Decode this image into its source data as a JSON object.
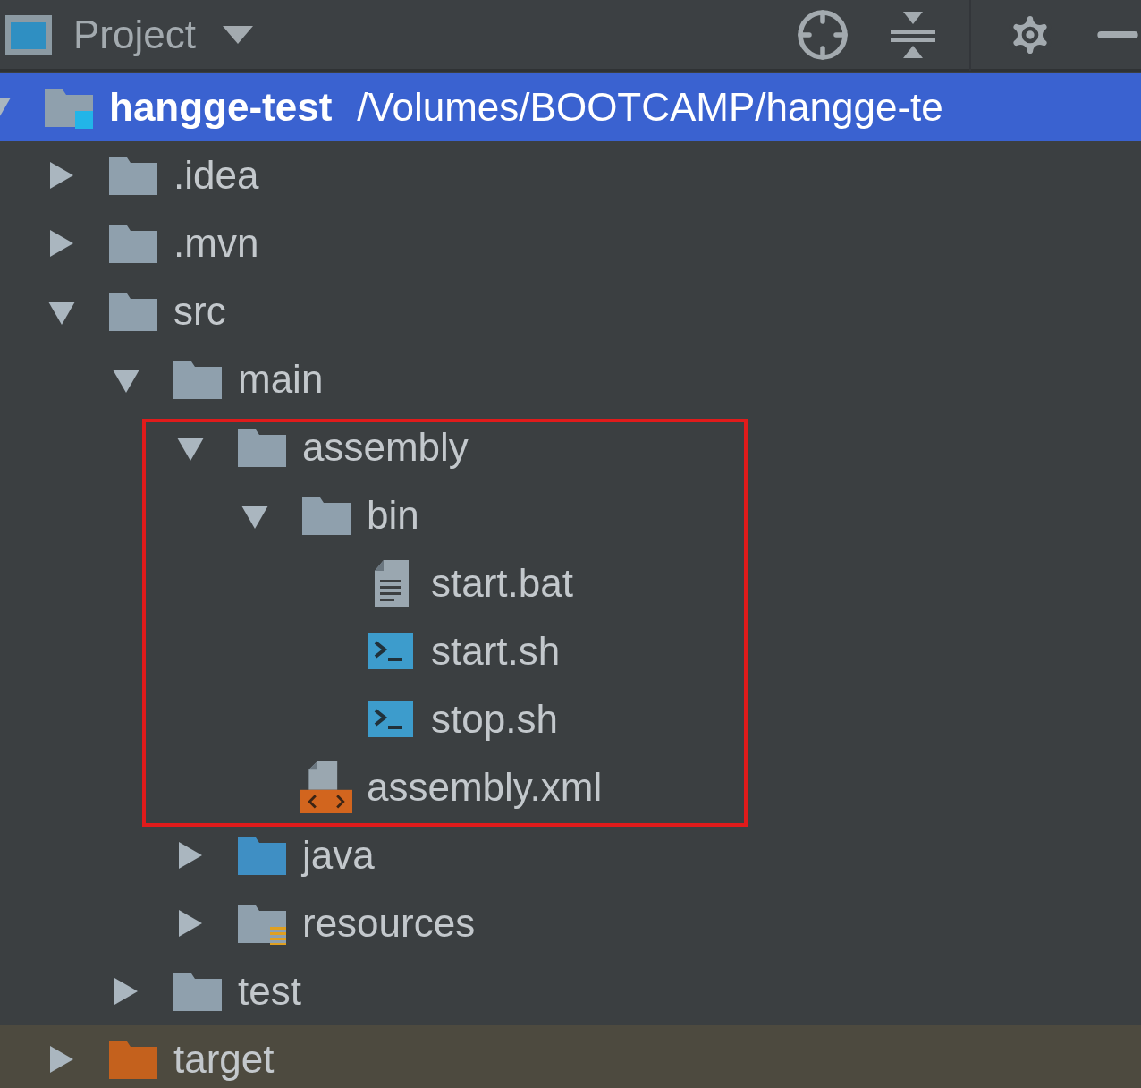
{
  "header": {
    "title": "Project"
  },
  "tree": [
    {
      "name": "hangge-test",
      "path": "/Volumes/BOOTCAMP/hangge-te",
      "kind": "module",
      "expanded": true,
      "selected": true,
      "children": [
        {
          "name": ".idea",
          "kind": "folder",
          "expanded": false,
          "selected": false
        },
        {
          "name": ".mvn",
          "kind": "folder",
          "expanded": false,
          "selected": false
        },
        {
          "name": "src",
          "kind": "folder",
          "expanded": true,
          "selected": false,
          "children": [
            {
              "name": "main",
              "kind": "folder",
              "expanded": true,
              "selected": false,
              "children": [
                {
                  "name": "assembly",
                  "kind": "folder",
                  "expanded": true,
                  "selected": false,
                  "highlighted": true,
                  "children": [
                    {
                      "name": "bin",
                      "kind": "folder",
                      "expanded": true,
                      "selected": false,
                      "children": [
                        {
                          "name": "start.bat",
                          "kind": "text-file",
                          "selected": false
                        },
                        {
                          "name": "start.sh",
                          "kind": "shell-script",
                          "selected": false
                        },
                        {
                          "name": "stop.sh",
                          "kind": "shell-script",
                          "selected": false
                        }
                      ]
                    },
                    {
                      "name": "assembly.xml",
                      "kind": "xml-file",
                      "selected": false
                    }
                  ]
                },
                {
                  "name": "java",
                  "kind": "source-folder",
                  "expanded": false,
                  "selected": false
                },
                {
                  "name": "resources",
                  "kind": "resource-folder",
                  "expanded": false,
                  "selected": false
                }
              ]
            },
            {
              "name": "test",
              "kind": "folder",
              "expanded": false,
              "selected": false
            }
          ]
        },
        {
          "name": "target",
          "kind": "excluded-folder",
          "expanded": false,
          "selected": false
        }
      ]
    }
  ]
}
